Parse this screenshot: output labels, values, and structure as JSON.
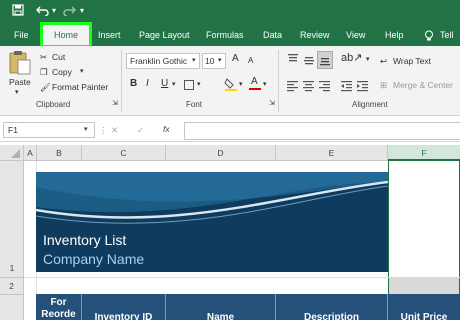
{
  "quick_access": {
    "save_icon": "save-icon",
    "undo_icon": "undo-icon",
    "redo_icon": "redo-icon"
  },
  "tabs": [
    {
      "label": "File"
    },
    {
      "label": "Home"
    },
    {
      "label": "Insert"
    },
    {
      "label": "Page Layout"
    },
    {
      "label": "Formulas"
    },
    {
      "label": "Data"
    },
    {
      "label": "Review"
    },
    {
      "label": "View"
    },
    {
      "label": "Help"
    },
    {
      "label": "Tell"
    }
  ],
  "clipboard": {
    "paste": "Paste",
    "cut": "Cut",
    "copy": "Copy",
    "format_painter": "Format Painter",
    "group_label": "Clipboard"
  },
  "font": {
    "family": "Franklin Gothic",
    "size": "10",
    "bold": "B",
    "italic": "I",
    "underline": "U",
    "grow": "A",
    "shrink": "A",
    "font_color_letter": "A",
    "group_label": "Font"
  },
  "alignment": {
    "wrap_text": "Wrap Text",
    "merge_center": "Merge & Center",
    "group_label": "Alignment"
  },
  "formula_bar": {
    "name_box": "F1",
    "cancel": "✕",
    "enter": "✓",
    "fx": "fx"
  },
  "columns": [
    "A",
    "B",
    "C",
    "D",
    "E",
    "F"
  ],
  "rows": [
    "1",
    "2"
  ],
  "banner": {
    "title": "Inventory List",
    "subtitle": "Company Name"
  },
  "table_headers": [
    "For Reorde",
    "Inventory ID",
    "Name",
    "Description",
    "Unit Price"
  ],
  "colors": {
    "ribbon_green": "#217346",
    "highlight": "#1aff1a",
    "banner_dark": "#0e3a5c",
    "table_header": "#25507a"
  }
}
